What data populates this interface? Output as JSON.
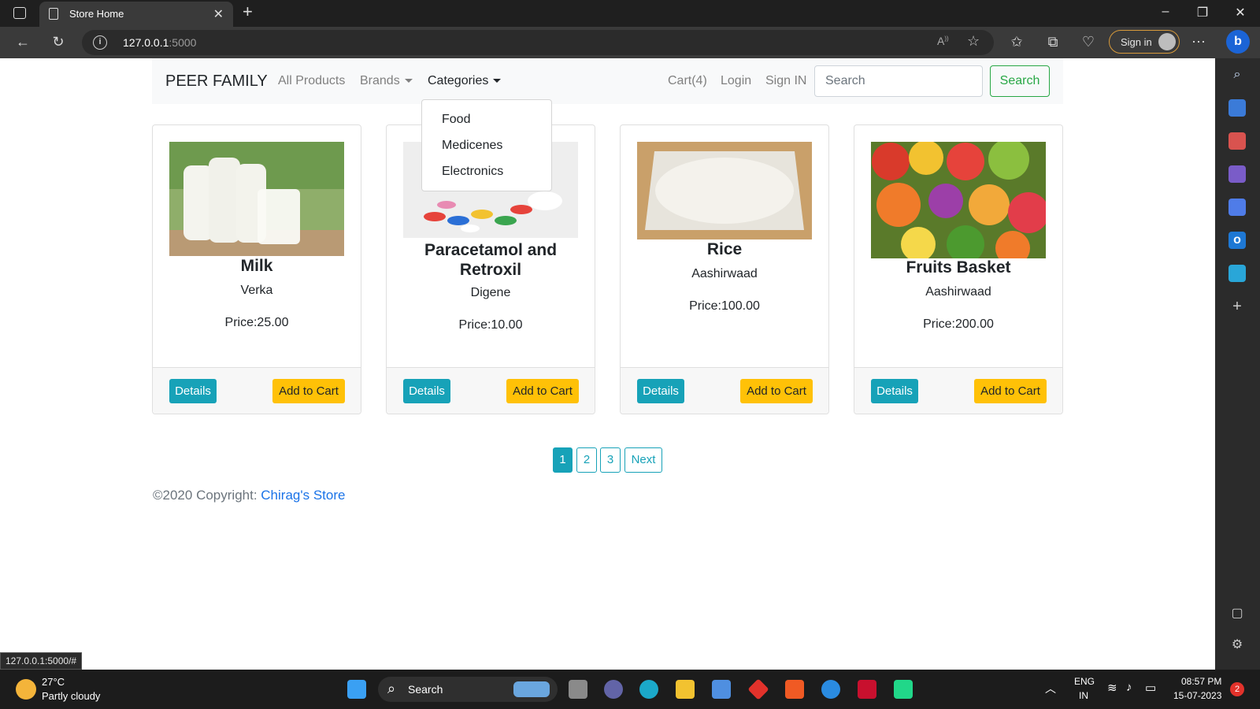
{
  "browser": {
    "tab_title": "Store Home",
    "tab_close": "✕",
    "new_tab": "+",
    "url_host": "127.0.0.1",
    "url_port": ":5000",
    "signin_label": "Sign in",
    "status_url": "127.0.0.1:5000/#"
  },
  "navbar": {
    "brand": "PEER FAMILY",
    "links": {
      "all_products": "All Products",
      "brands": "Brands",
      "categories": "Categories",
      "cart": "Cart(4)",
      "login": "Login",
      "sign_in": "Sign IN"
    },
    "search_placeholder": "Search",
    "search_button": "Search"
  },
  "categories_menu": [
    "Food",
    "Medicenes",
    "Electronics"
  ],
  "products": [
    {
      "title": "Milk",
      "brand": "Verka",
      "price": "Price:25.00",
      "details": "Details",
      "add": "Add to Cart",
      "image": "milk-bottles"
    },
    {
      "title_line1": "Paracetamol and",
      "title_line2": "Retroxil",
      "brand": "Digene",
      "price": "Price:10.00",
      "details": "Details",
      "add": "Add to Cart",
      "image": "pills"
    },
    {
      "title": "Rice",
      "brand": "Aashirwaad",
      "price": "Price:100.00",
      "details": "Details",
      "add": "Add to Cart",
      "image": "rice-bowl"
    },
    {
      "title": "Fruits Basket",
      "brand": "Aashirwaad",
      "price": "Price:200.00",
      "details": "Details",
      "add": "Add to Cart",
      "image": "fruits"
    }
  ],
  "pagination": [
    "1",
    "2",
    "3",
    "Next"
  ],
  "footer": {
    "text": "©2020 Copyright: ",
    "link": "Chirag's Store"
  },
  "taskbar": {
    "temp": "27°C",
    "weather": "Partly cloudy",
    "search": "Search",
    "lang1": "ENG",
    "lang2": "IN",
    "time": "08:57 PM",
    "date": "15-07-2023",
    "notif": "2"
  },
  "colors": {
    "primary_info": "#17a2b8",
    "warning": "#ffc107",
    "success": "#28a745"
  }
}
